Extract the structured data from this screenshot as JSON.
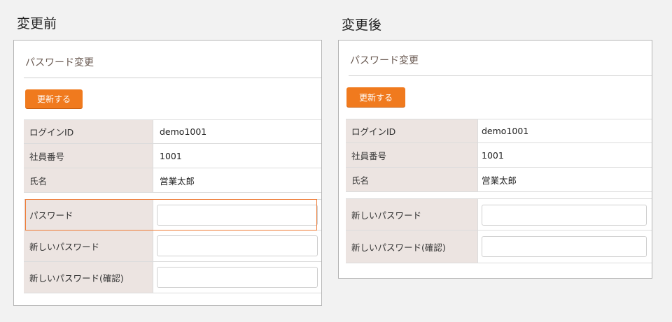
{
  "before": {
    "heading": "変更前",
    "panel_title": "パスワード変更",
    "update_button": "更新する",
    "info_rows": [
      {
        "label": "ログインID",
        "value": "demo1001"
      },
      {
        "label": "社員番号",
        "value": "1001"
      },
      {
        "label": "氏名",
        "value": "営業太郎"
      }
    ],
    "password_rows": [
      {
        "label": "パスワード",
        "value": ""
      },
      {
        "label": "新しいパスワード",
        "value": ""
      },
      {
        "label": "新しいパスワード(確認)",
        "value": ""
      }
    ]
  },
  "after": {
    "heading": "変更後",
    "panel_title": "パスワード変更",
    "update_button": "更新する",
    "info_rows": [
      {
        "label": "ログインID",
        "value": "demo1001"
      },
      {
        "label": "社員番号",
        "value": "1001"
      },
      {
        "label": "氏名",
        "value": "営業太郎"
      }
    ],
    "password_rows": [
      {
        "label": "新しいパスワード",
        "value": ""
      },
      {
        "label": "新しいパスワード(確認)",
        "value": ""
      }
    ]
  },
  "colors": {
    "accent": "#f07a1e",
    "label_background": "#ece4e1",
    "highlight_border": "#ee7a35",
    "page_background": "#f2f2f2"
  }
}
